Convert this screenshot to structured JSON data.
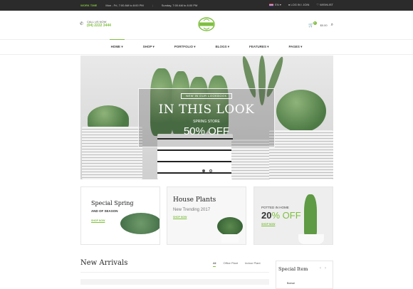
{
  "topbar": {
    "work_label": "WORK TIME",
    "hours_weekday": "Mon - Fri, 7:00 AM to 8:00 PM",
    "hours_sunday": "Sunday, 7:00 AM to 8:00 PM",
    "language": "EN",
    "login": "LOG IN / JOIN",
    "wishlist": "WISHLIST"
  },
  "header": {
    "call_label": "CALL US NOW",
    "phone": "(04) 2222 3444",
    "cart_count": "0",
    "cart_total": "$0.00"
  },
  "nav": {
    "items": [
      {
        "label": "HOME ▾"
      },
      {
        "label": "SHOP ▾"
      },
      {
        "label": "PORTFOLIO ▾"
      },
      {
        "label": "BLOGS ▾"
      },
      {
        "label": "FEATURES ▾"
      },
      {
        "label": "PAGES ▾"
      }
    ]
  },
  "hero": {
    "tag": "NEW IN OUR LOOKBOOK",
    "title": "IN THIS LOOK",
    "subtitle": "SPRING STORE",
    "offer": "50% OFF"
  },
  "banners": {
    "b1": {
      "title": "Special Spring",
      "sub": "AND OF SEASON",
      "shop": "SHOP NOW"
    },
    "b2": {
      "title": "House Plants",
      "sub": "New Trending 2017",
      "shop": "SHOP NOW"
    },
    "b3": {
      "label": "POTTED IN HOME",
      "percent": "20",
      "unit": "% OFF",
      "shop": "SHOP NOW"
    }
  },
  "new_arrivals": {
    "title": "New Arrivals",
    "tabs": [
      {
        "label": "All"
      },
      {
        "label": "Office Plant"
      },
      {
        "label": "Indoor Plant"
      }
    ]
  },
  "special": {
    "title": "Special Item",
    "item_label": "Bonsai"
  },
  "colors": {
    "accent": "#7fbf3f",
    "topbar": "#2b2b2b"
  }
}
